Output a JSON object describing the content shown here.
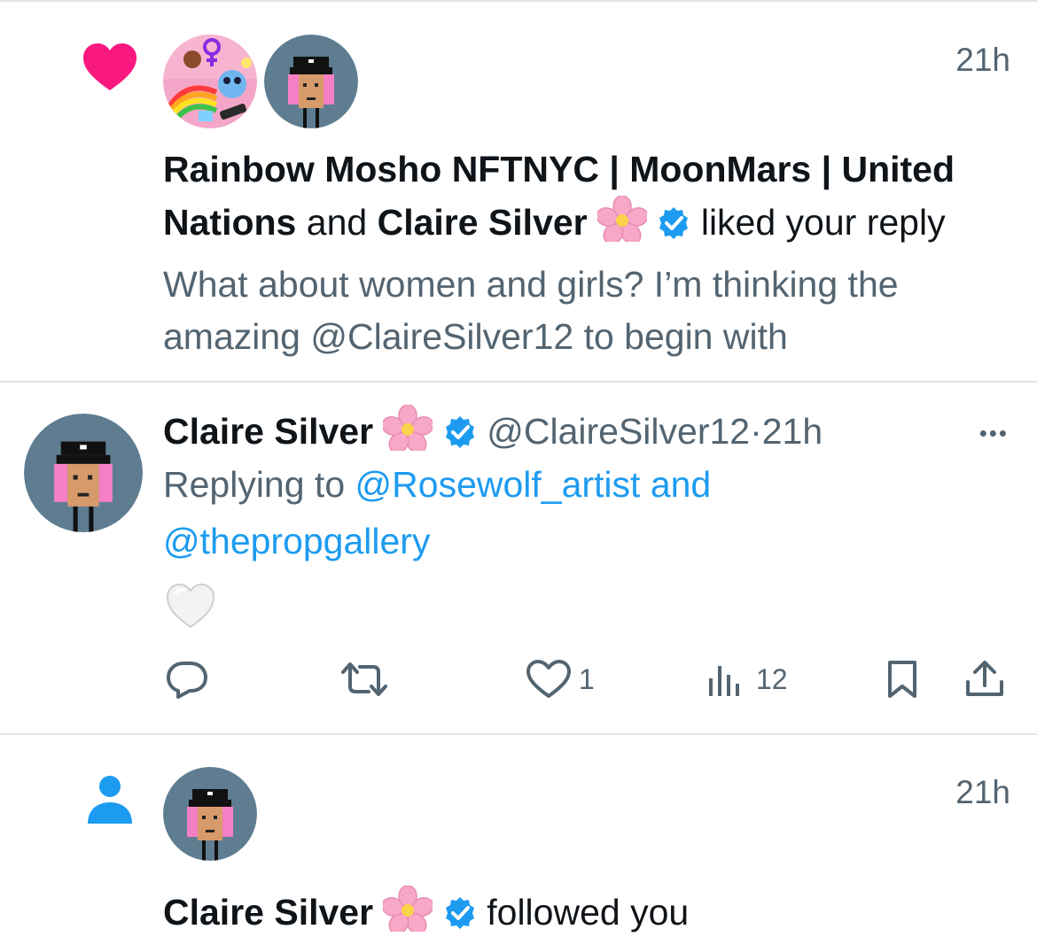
{
  "notification_like": {
    "time": "21h",
    "actor1_line1": "Rainbow Mosho NFTNYC | MoonMars | United",
    "actor1_line2": "Nations",
    "joiner": "and",
    "actor2": "Claire Silver",
    "action": "liked your reply",
    "quoted_line1": "What about women and girls? I’m thinking the",
    "quoted_line2": "amazing @ClaireSilver12 to begin with",
    "icon": "heart-icon",
    "color": "#f91880"
  },
  "reply_tweet": {
    "author_name": "Claire Silver",
    "handle": "@ClaireSilver12",
    "separator": "·",
    "time": "21h",
    "more": "•••",
    "replying_prefix": "Replying to",
    "replying_user1": "@Rosewolf_artist and",
    "replying_user2": "@thepropgallery",
    "body_emoji": "white-heart",
    "actions": {
      "reply_count": "",
      "retweet_count": "",
      "like_count": "1",
      "view_count": "12"
    }
  },
  "notification_follow": {
    "time": "21h",
    "actor": "Claire Silver",
    "action": "followed you",
    "icon": "person-icon",
    "color": "#1d9bf0"
  },
  "colors": {
    "verified": "#1d9bf0",
    "text": "#0f1419",
    "secondary": "#536471",
    "divider": "#e3e6e9"
  }
}
